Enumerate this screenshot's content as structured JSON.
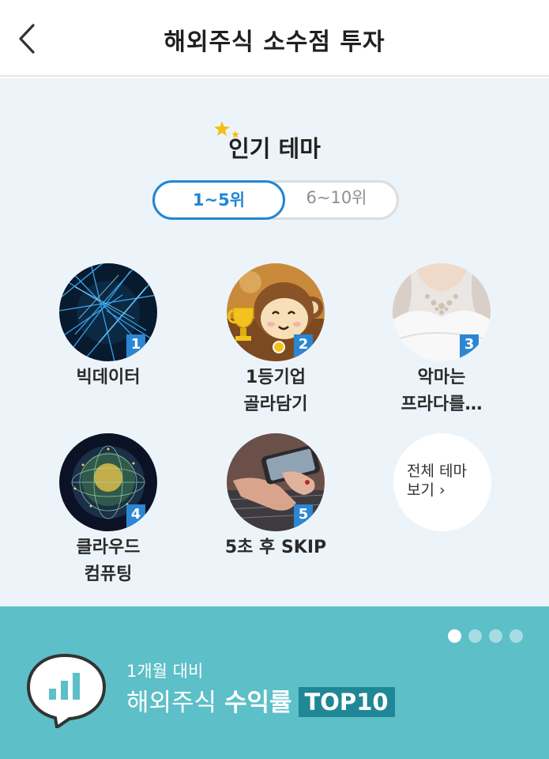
{
  "header": {
    "title": "해외주식 소수점 투자"
  },
  "section": {
    "title": "인기 테마"
  },
  "tabs": [
    {
      "label": "1~5위",
      "active": true
    },
    {
      "label": "6~10위",
      "active": false
    }
  ],
  "themes": [
    {
      "rank": "1",
      "label": "빅데이터"
    },
    {
      "rank": "2",
      "label": "1등기업\n골라담기"
    },
    {
      "rank": "3",
      "label": "악마는\n프라다를…"
    },
    {
      "rank": "4",
      "label": "클라우드\n컴퓨팅"
    },
    {
      "rank": "5",
      "label": "5초 후 SKIP"
    }
  ],
  "all_theme": {
    "label_line1": "전체 테마",
    "label_line2": "보기 ›"
  },
  "banner": {
    "subtitle": "1개월 대비",
    "title_light": "해외주식 ",
    "title_bold": "수익률",
    "badge": "TOP10",
    "dots": 4,
    "active_dot": 0
  },
  "colors": {
    "accent": "#1f86d6",
    "banner_bg": "#5dbfc8",
    "section_bg": "#edf4f9"
  }
}
